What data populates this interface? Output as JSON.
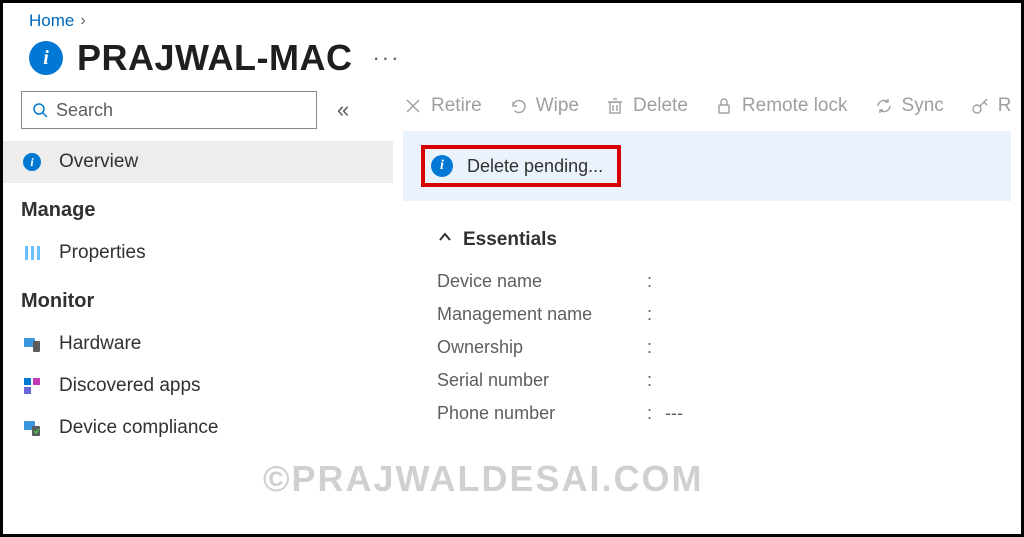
{
  "breadcrumb": {
    "home": "Home"
  },
  "title": "PRAJWAL-MAC",
  "searchPlaceholder": "Search",
  "sidebar": {
    "overview": "Overview",
    "sections": {
      "manage": "Manage",
      "monitor": "Monitor"
    },
    "items": {
      "properties": "Properties",
      "hardware": "Hardware",
      "discovered": "Discovered apps",
      "compliance": "Device compliance"
    }
  },
  "toolbar": {
    "retire": "Retire",
    "wipe": "Wipe",
    "delete": "Delete",
    "remoteLock": "Remote lock",
    "sync": "Sync",
    "reset": "R"
  },
  "banner": {
    "message": "Delete pending..."
  },
  "essentials": {
    "heading": "Essentials",
    "rows": [
      {
        "label": "Device name",
        "value": ""
      },
      {
        "label": "Management name",
        "value": ""
      },
      {
        "label": "Ownership",
        "value": ""
      },
      {
        "label": "Serial number",
        "value": ""
      },
      {
        "label": "Phone number",
        "value": "---"
      }
    ]
  },
  "watermark": "©PRAJWALDESAI.COM"
}
